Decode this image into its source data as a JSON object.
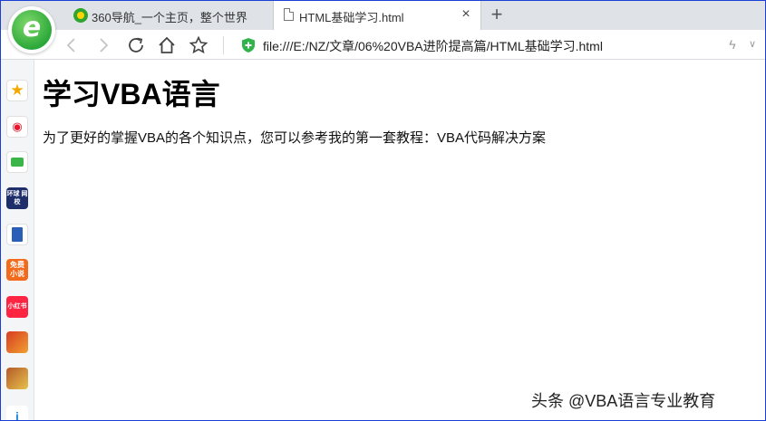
{
  "tabs": [
    {
      "title": "360导航_一个主页，整个世界",
      "active": false
    },
    {
      "title": "HTML基础学习.html",
      "active": true
    }
  ],
  "toolbar": {
    "address": "file:///E:/NZ/文章/06%20VBA进阶提高篇/HTML基础学习.html"
  },
  "sidebar": {
    "items": [
      {
        "icon": "favorites-star-icon"
      },
      {
        "icon": "weibo-icon"
      },
      {
        "icon": "mail-icon"
      },
      {
        "icon": "huanqiu-icon",
        "text": "环球 网校"
      },
      {
        "icon": "word-doc-icon"
      },
      {
        "icon": "novel-icon",
        "text": "免费 小说"
      },
      {
        "icon": "xiaohongshu-icon",
        "text": "小红书"
      },
      {
        "icon": "game-icon"
      },
      {
        "icon": "game-icon"
      },
      {
        "icon": "app-icon"
      }
    ]
  },
  "page": {
    "heading": "学习VBA语言",
    "paragraph": "为了更好的掌握VBA的各个知识点，您可以参考我的第一套教程：VBA代码解决方案"
  },
  "watermark": "头条 @VBA语言专业教育",
  "colors": {
    "window_border": "#1a3fd6",
    "tab_strip": "#dfe3e8",
    "shield": "#2fb34a",
    "logo_green": "#2ca83a"
  }
}
